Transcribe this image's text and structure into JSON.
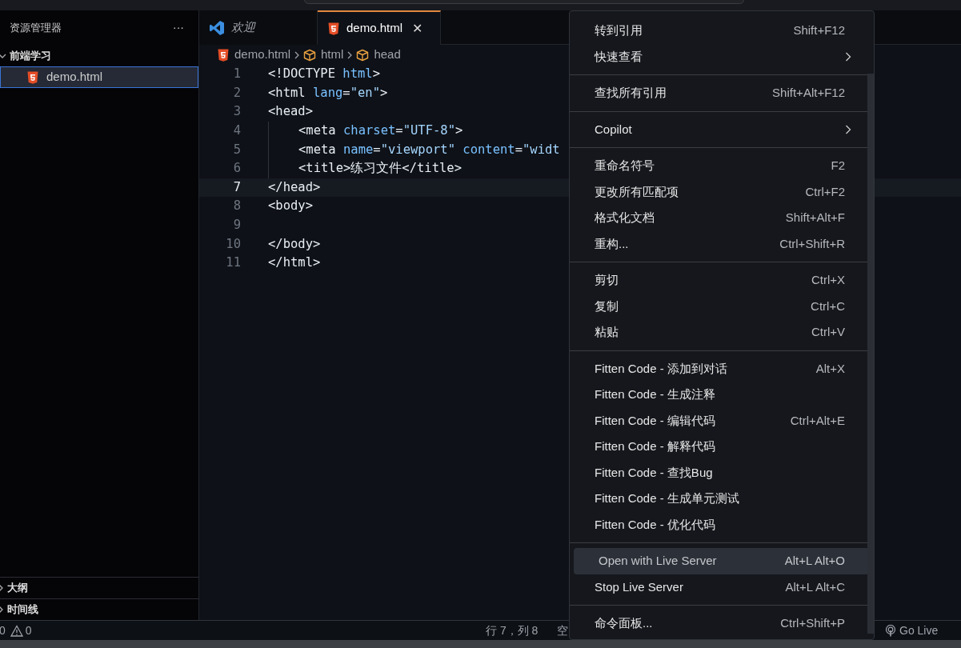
{
  "sidebar": {
    "title": "资源管理器",
    "more": "···",
    "tree": [
      {
        "label": "前端学习",
        "expanded": true,
        "children": [
          {
            "label": "demo.html",
            "selected": true
          }
        ]
      }
    ],
    "panels": [
      {
        "label": "大纲",
        "expanded": false
      },
      {
        "label": "时间线",
        "expanded": false
      }
    ]
  },
  "tabs": [
    {
      "label": "欢迎",
      "kind": "welcome",
      "selected": false
    },
    {
      "label": "demo.html",
      "kind": "html",
      "selected": true,
      "close": "✕"
    }
  ],
  "breadcrumbs": [
    {
      "label": "demo.html",
      "kind": "html"
    },
    {
      "label": "html",
      "kind": "symbol"
    },
    {
      "label": "head",
      "kind": "symbol"
    }
  ],
  "code": [
    {
      "number": "1",
      "current": false,
      "tokens": [
        {
          "kind": "tag",
          "text": "<!DOCTYPE "
        },
        {
          "kind": "attr",
          "text": "html"
        },
        {
          "kind": "tag",
          "text": ">"
        }
      ]
    },
    {
      "number": "2",
      "current": false,
      "tokens": [
        {
          "kind": "tag",
          "text": "<html "
        },
        {
          "kind": "attr",
          "text": "lang"
        },
        {
          "kind": "tag",
          "text": "="
        },
        {
          "kind": "string",
          "text": "\"en\""
        },
        {
          "kind": "tag",
          "text": ">"
        }
      ]
    },
    {
      "number": "3",
      "current": false,
      "tokens": [
        {
          "kind": "tag",
          "text": "<head>"
        }
      ],
      "children": [
        {
          "number": "4",
          "current": false,
          "tokens": [
            {
              "kind": "tag",
              "text": "<meta "
            },
            {
              "kind": "attr",
              "text": "charset"
            },
            {
              "kind": "tag",
              "text": "="
            },
            {
              "kind": "string",
              "text": "\"UTF-8\""
            },
            {
              "kind": "tag",
              "text": ">"
            }
          ]
        },
        {
          "number": "5",
          "current": false,
          "tokens": [
            {
              "kind": "tag",
              "text": "<meta "
            },
            {
              "kind": "attr",
              "text": "name"
            },
            {
              "kind": "tag",
              "text": "="
            },
            {
              "kind": "string",
              "text": "\"viewport\" "
            },
            {
              "kind": "attr",
              "text": "content"
            },
            {
              "kind": "tag",
              "text": "="
            },
            {
              "kind": "string",
              "text": "\"widt"
            }
          ]
        },
        {
          "number": "6",
          "current": false,
          "tokens": [
            {
              "kind": "tag",
              "text": "<title>"
            },
            {
              "kind": "text",
              "text": "练习文件"
            },
            {
              "kind": "tag",
              "text": "</title>"
            }
          ]
        }
      ]
    },
    {
      "number": "7",
      "current": true,
      "tokens": [
        {
          "kind": "tag",
          "text": "</head>"
        }
      ]
    },
    {
      "number": "8",
      "current": false,
      "tokens": [
        {
          "kind": "tag",
          "text": "<body>"
        }
      ]
    },
    {
      "number": "9",
      "current": false
    },
    {
      "number": "10",
      "current": false,
      "tokens": [
        {
          "kind": "tag",
          "text": "</body>"
        }
      ]
    },
    {
      "number": "11",
      "current": false,
      "tokens": [
        {
          "kind": "tag",
          "text": "</html>"
        }
      ]
    }
  ],
  "status_bar": {
    "errors": "0",
    "warnings": "0",
    "position": "行 7，列 8",
    "indent": "空",
    "go_live": "Go Live"
  },
  "context_menu": {
    "groups": [
      [
        {
          "label": "转到引用",
          "shortcut": "Shift+F12",
          "selected": false
        },
        {
          "label": "快速查看",
          "submenu": true,
          "selected": false
        }
      ],
      [
        {
          "label": "查找所有引用",
          "shortcut": "Shift+Alt+F12",
          "selected": false
        }
      ],
      [
        {
          "label": "Copilot",
          "submenu": true,
          "selected": false
        }
      ],
      [
        {
          "label": "重命名符号",
          "shortcut": "F2",
          "selected": false
        },
        {
          "label": "更改所有匹配项",
          "shortcut": "Ctrl+F2",
          "selected": false
        },
        {
          "label": "格式化文档",
          "shortcut": "Shift+Alt+F",
          "selected": false
        },
        {
          "label": "重构...",
          "shortcut": "Ctrl+Shift+R",
          "selected": false
        }
      ],
      [
        {
          "label": "剪切",
          "shortcut": "Ctrl+X",
          "selected": false
        },
        {
          "label": "复制",
          "shortcut": "Ctrl+C",
          "selected": false
        },
        {
          "label": "粘贴",
          "shortcut": "Ctrl+V",
          "selected": false
        }
      ],
      [
        {
          "label": "Fitten Code - 添加到对话",
          "shortcut": "Alt+X",
          "selected": false
        },
        {
          "label": "Fitten Code - 生成注释",
          "selected": false
        },
        {
          "label": "Fitten Code - 编辑代码",
          "shortcut": "Ctrl+Alt+E",
          "selected": false
        },
        {
          "label": "Fitten Code - 解释代码",
          "selected": false
        },
        {
          "label": "Fitten Code - 查找Bug",
          "selected": false
        },
        {
          "label": "Fitten Code - 生成单元测试",
          "selected": false
        },
        {
          "label": "Fitten Code - 优化代码",
          "selected": false
        }
      ],
      [
        {
          "label": "Open with Live Server",
          "shortcut": "Alt+L Alt+O",
          "selected": true
        },
        {
          "label": "Stop Live Server",
          "shortcut": "Alt+L Alt+C",
          "selected": false
        }
      ],
      [
        {
          "label": "命令面板...",
          "shortcut": "Ctrl+Shift+P",
          "selected": false
        }
      ]
    ]
  }
}
